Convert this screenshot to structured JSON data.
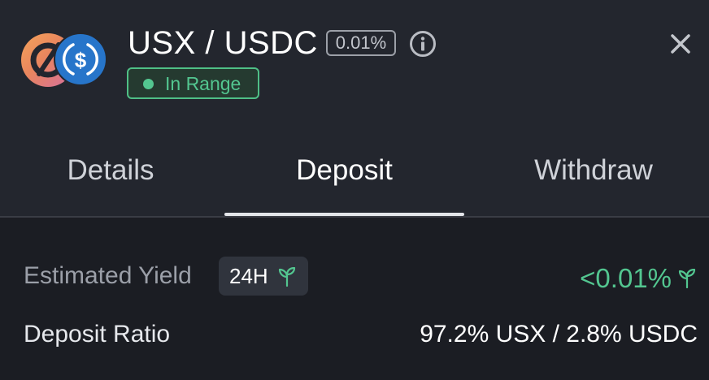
{
  "pool": {
    "pair_title": "USX / USDC",
    "fee_tier": "0.01%",
    "status_badge": "In Range",
    "tokens": [
      "USX",
      "USDC"
    ]
  },
  "tabs": [
    {
      "label": "Details",
      "active": false
    },
    {
      "label": "Deposit",
      "active": true
    },
    {
      "label": "Withdraw",
      "active": false
    }
  ],
  "yield": {
    "label": "Estimated Yield",
    "period": "24H",
    "value": "<0.01%"
  },
  "ratio": {
    "label": "Deposit Ratio",
    "value": "97.2% USX / 2.8% USDC"
  },
  "icons": {
    "info": "info-icon",
    "close": "close-icon",
    "yield": "sprout-icon"
  },
  "colors": {
    "accent_green": "#53c690",
    "header_bg": "#23262e",
    "body_bg": "#1b1d23",
    "usdc_blue": "#2775ca"
  }
}
